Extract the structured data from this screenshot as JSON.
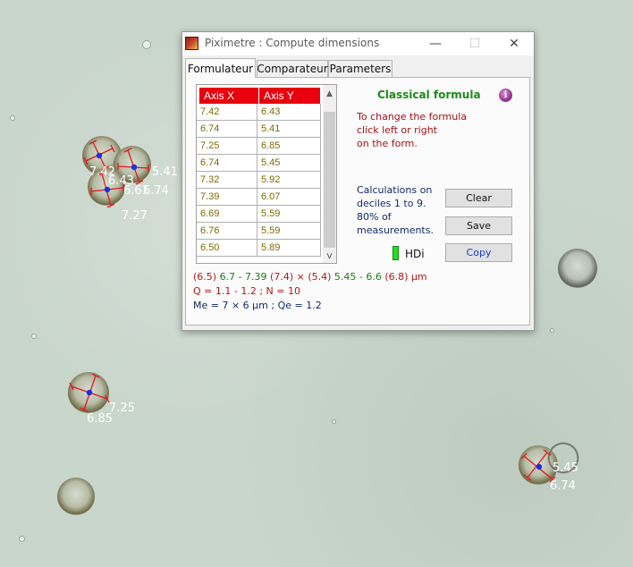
{
  "background": {
    "measurements": [
      {
        "axis_x": "7.42",
        "axis_y": "6.43"
      },
      {
        "axis_x": "6.74",
        "axis_y": "5.41"
      },
      {
        "axis_x": "7.27",
        "axis_y": "6.61"
      },
      {
        "axis_x": "7.25",
        "axis_y": "6.85"
      },
      {
        "axis_x": "5.45",
        "axis_y": "6.74"
      }
    ]
  },
  "window": {
    "title": "Piximetre : Compute dimensions",
    "controls": {
      "minimize": "—",
      "maximize": "☐",
      "close": "✕"
    },
    "tabs": [
      {
        "label": "Formulateur",
        "active": true
      },
      {
        "label": "Comparateur",
        "active": false
      },
      {
        "label": "Parameters",
        "active": false
      }
    ],
    "grid": {
      "headers": [
        "Axis X",
        "Axis Y"
      ],
      "rows": [
        [
          "7.42",
          "6.43"
        ],
        [
          "6.74",
          "5.41"
        ],
        [
          "7.25",
          "6.85"
        ],
        [
          "6.74",
          "5.45"
        ],
        [
          "7.32",
          "5.92"
        ],
        [
          "7.39",
          "6.07"
        ],
        [
          "6.69",
          "5.59"
        ],
        [
          "6.76",
          "5.59"
        ],
        [
          "6.50",
          "5.89"
        ]
      ],
      "scroll_up": "▲",
      "scroll_down": "v"
    },
    "formula": {
      "title": "Classical formula",
      "info_glyph": "i",
      "hint_lines": [
        "To change the formula",
        "click left or right",
        "on the form."
      ]
    },
    "calculations": {
      "lines": [
        "Calculations on",
        "deciles 1 to 9.",
        "80% of",
        "measurements."
      ]
    },
    "buttons": {
      "clear": "Clear",
      "save": "Save",
      "copy": "Copy"
    },
    "hdi": {
      "label": "HDi",
      "color": "#22e022"
    },
    "results": {
      "size_parts": [
        {
          "text": "(6.5) ",
          "color": "#b01818"
        },
        {
          "text": "6.7 - 7.39 ",
          "color": "#1a7a1a"
        },
        {
          "text": "(7.4) × (5.4) ",
          "color": "#b01818"
        },
        {
          "text": "5.45 - 6.6 ",
          "color": "#1a7a1a"
        },
        {
          "text": "(6.8) ",
          "color": "#b01818"
        },
        {
          "text": "µm",
          "color": "#b01818"
        }
      ],
      "q_line": "Q = 1.1 - 1.2 ; N = 10",
      "me_line": "Me = 7 × 6 µm ; Qe = 1.2",
      "q_color": "#b01818",
      "me_color": "#14286b"
    }
  }
}
